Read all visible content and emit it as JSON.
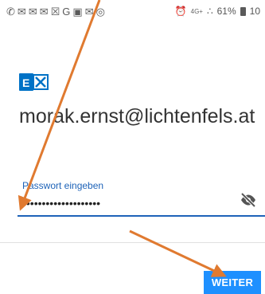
{
  "status_bar": {
    "left_icons": [
      "whatsapp-icon",
      "mail-icon",
      "mail-icon",
      "mail-icon",
      "x-app-icon",
      "google-icon",
      "photo-icon",
      "mail-icon",
      "instagram-icon"
    ],
    "left_glyphs": [
      "✆",
      "✉",
      "✉",
      "✉",
      "☒",
      "G",
      "▣",
      "✉",
      "◎"
    ],
    "alarm_glyph": "⏰",
    "network": "4G+",
    "signal": "∴",
    "battery_percent": "61%",
    "time": "10"
  },
  "app": {
    "brand_color": "#0072c6",
    "accent_color": "#1e63b8",
    "button_color": "#1e90ff"
  },
  "account": {
    "email": "morak.ernst@lichtenfels.at"
  },
  "password": {
    "label": "Passwort eingeben",
    "value": "••••••••••••••••••••"
  },
  "actions": {
    "next_label": "WEITER"
  },
  "annotation": {
    "arrow_color": "#e07a30"
  }
}
